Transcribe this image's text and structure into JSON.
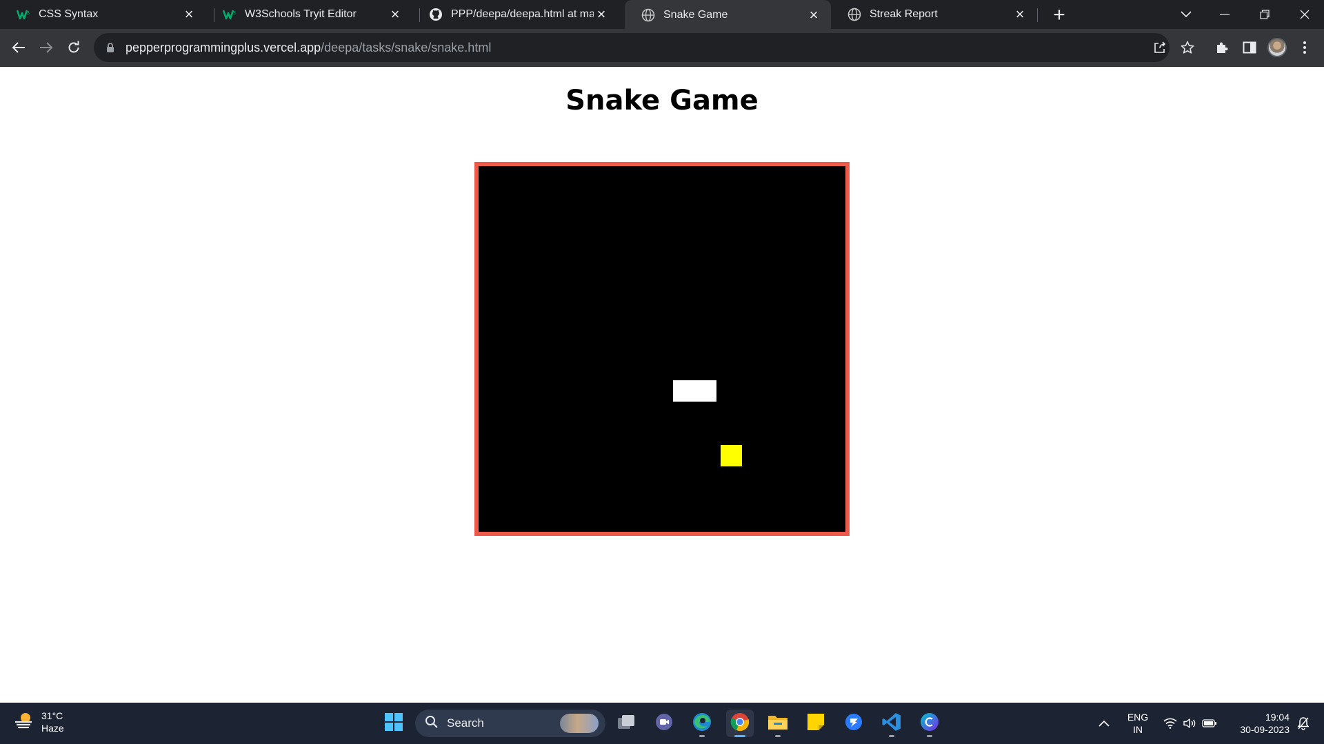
{
  "browser": {
    "tabs": [
      {
        "title": "CSS Syntax",
        "icon": "w3schools-icon",
        "active": false
      },
      {
        "title": "W3Schools Tryit Editor",
        "icon": "w3schools-icon",
        "active": false
      },
      {
        "title": "PPP/deepa/deepa.html at main ·",
        "icon": "github-icon",
        "active": false
      },
      {
        "title": "Snake Game",
        "icon": "globe-icon",
        "active": true
      },
      {
        "title": "Streak Report",
        "icon": "globe-icon",
        "active": false
      }
    ],
    "close_glyph": "×",
    "new_tab_glyph": "+",
    "address": {
      "host": "pepperprogrammingplus.vercel.app",
      "path": "/deepa/tasks/snake/snake.html"
    }
  },
  "page": {
    "title": "Snake Game",
    "colors": {
      "board_background": "#000000",
      "board_border": "#ee5a4a",
      "snake": "#ffffff",
      "food": "#ffff00"
    }
  },
  "taskbar": {
    "weather": {
      "temp": "31°C",
      "condition": "Haze"
    },
    "search_label": "Search",
    "language": {
      "line1": "ENG",
      "line2": "IN"
    },
    "clock": {
      "time": "19:04",
      "date": "30-09-2023"
    }
  }
}
